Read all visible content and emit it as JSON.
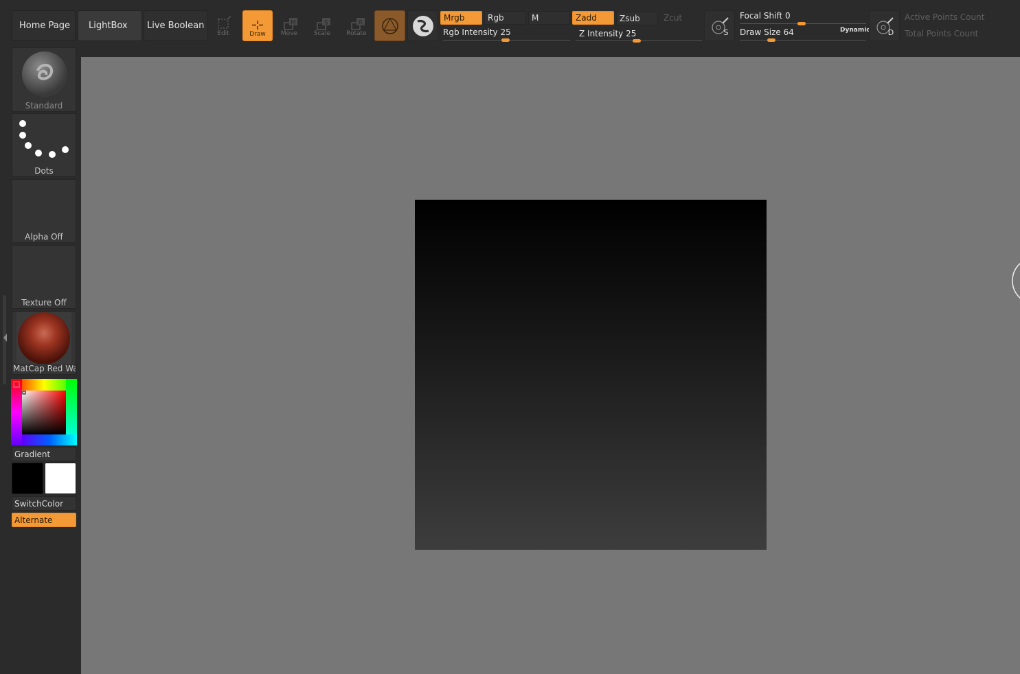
{
  "toolbar": {
    "home_page": "Home Page",
    "lightbox": "LightBox",
    "live_boolean": "Live Boolean",
    "tools": [
      {
        "name": "edit",
        "label": "Edit"
      },
      {
        "name": "draw",
        "label": "Draw"
      },
      {
        "name": "move",
        "label": "Move"
      },
      {
        "name": "scale",
        "label": "Scale"
      },
      {
        "name": "rotate",
        "label": "Rotate"
      }
    ],
    "mrgb": "Mrgb",
    "rgb": "Rgb",
    "m": "M",
    "zadd": "Zadd",
    "zsub": "Zsub",
    "zcut": "Zcut",
    "rgb_intensity_label": "Rgb Intensity",
    "rgb_intensity_value": "25",
    "z_intensity_label": "Z Intensity",
    "z_intensity_value": "25",
    "focal_shift_label": "Focal Shift",
    "focal_shift_value": "0",
    "draw_size_label": "Draw Size",
    "draw_size_value": "64",
    "dynamic": "Dynamic",
    "lightbox_icon_s": "S",
    "lightbox_icon_d": "D",
    "active_points": "Active Points Count",
    "total_points": "Total Points Count"
  },
  "shelf": {
    "brush": "Standard",
    "stroke": "Dots",
    "alpha": "Alpha Off",
    "texture": "Texture Off",
    "material": "MatCap Red Wax",
    "gradient": "Gradient",
    "switch_color": "SwitchColor",
    "alternate": "Alternate"
  },
  "colors": {
    "accent": "#f39a37",
    "canvas_bg": "#777777",
    "ui_bg": "#2b2b2b",
    "main_color": "#000000",
    "secondary_color": "#ffffff"
  }
}
